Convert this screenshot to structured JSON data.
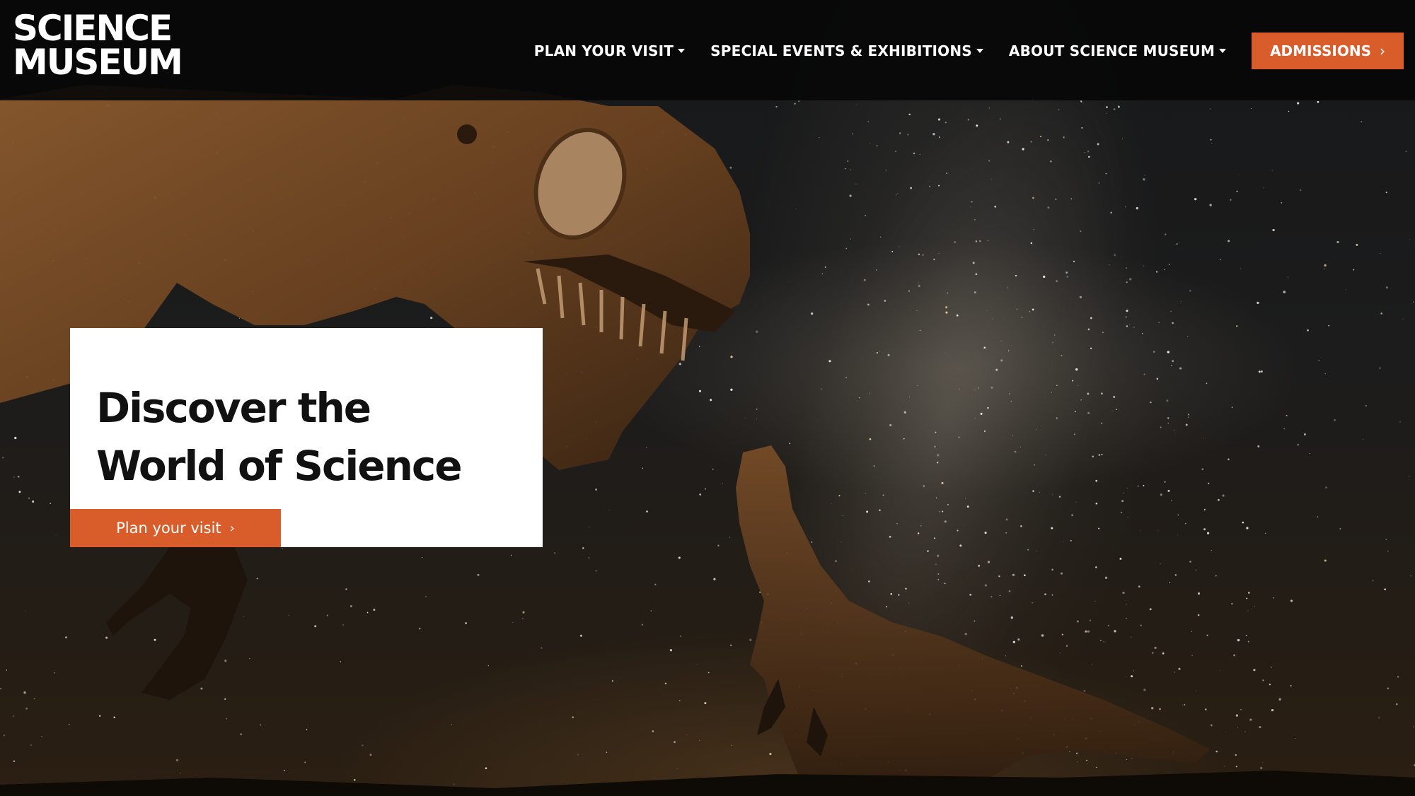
{
  "brand": {
    "logo_line1": "SCIENCE",
    "logo_line2": "MUSEUM"
  },
  "nav": {
    "items": [
      {
        "label": "PLAN YOUR VISIT"
      },
      {
        "label": "SPECIAL EVENTS & EXHIBITIONS"
      },
      {
        "label": "ABOUT SCIENCE MUSEUM"
      }
    ],
    "admissions_label": "ADMISSIONS"
  },
  "hero": {
    "headline_line1": "Discover the",
    "headline_line2": "World of Science",
    "cta_label": "Plan your visit"
  },
  "icons": {
    "dropdown": "caret-down-icon",
    "chevron": "chevron-right-icon"
  },
  "colors": {
    "accent": "#d95d2b",
    "header_bg": "#080808",
    "card_bg": "#ffffff",
    "headline": "#111111"
  }
}
